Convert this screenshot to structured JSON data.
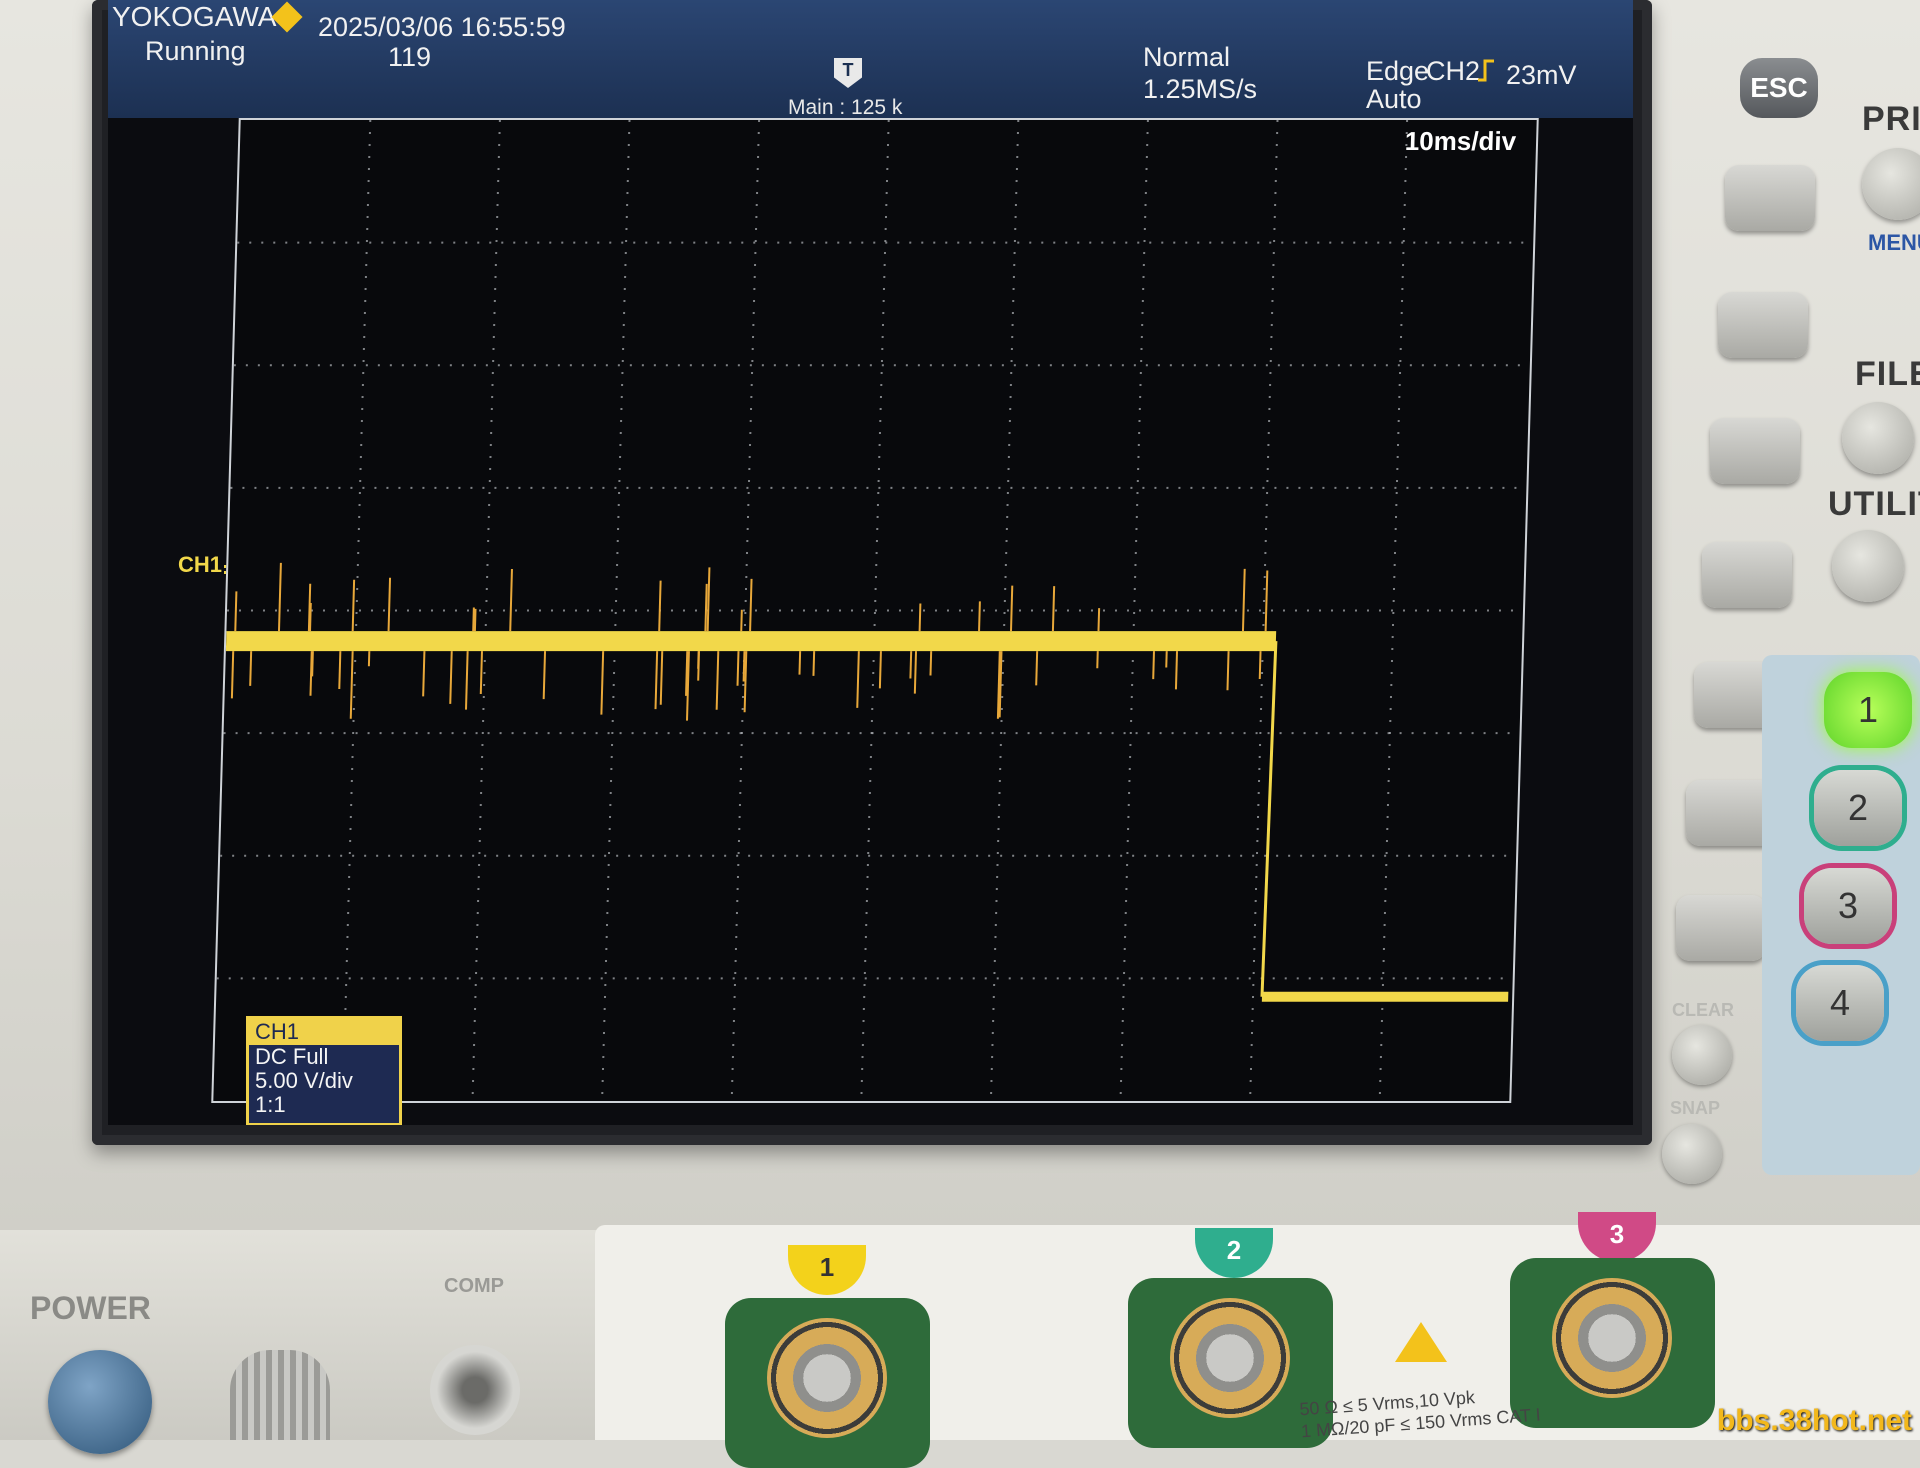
{
  "header": {
    "brand": "YOKOGAWA",
    "datetime": "2025/03/06 16:55:59",
    "run_state": "Running",
    "acq_count": "119",
    "trigger_mode": "Normal",
    "sample_rate": "1.25MS/s",
    "trigger_type": "Edge",
    "trigger_source": "CH2",
    "trigger_level": "23mV",
    "trigger_auto": "Auto"
  },
  "display": {
    "trigger_marker": "T",
    "main_label": "Main : 125 k",
    "timebase": "10ms/div",
    "channel_marker": "CH1",
    "channel_color": "#f2d84a",
    "grid_color": "#cfd3d8",
    "waveform": {
      "description_level_high_div": -0.25,
      "drop_time_div": 8.1,
      "level_low_div": -3.15
    }
  },
  "channel_box": {
    "title": "CH1",
    "coupling": "DC Full",
    "scale": "5.00 V/div",
    "probe": "1:1"
  },
  "panel": {
    "esc": "ESC",
    "print": "PRIN",
    "menu": "MENU",
    "file": "FILE",
    "utility": "UTILITY",
    "clear": "CLEAR",
    "snap": "SNAP",
    "channels": [
      "1",
      "2",
      "3",
      "4"
    ]
  },
  "front": {
    "power": "POWER",
    "comp": "COMP",
    "inputs": [
      "1",
      "2",
      "3"
    ],
    "spec_line1": "50 Ω ≤ 5 Vrms,10 Vpk",
    "spec_line2": "1 MΩ/20 pF ≤ 150 Vrms  CAT I",
    "watermark": "bbs.38hot.net"
  }
}
